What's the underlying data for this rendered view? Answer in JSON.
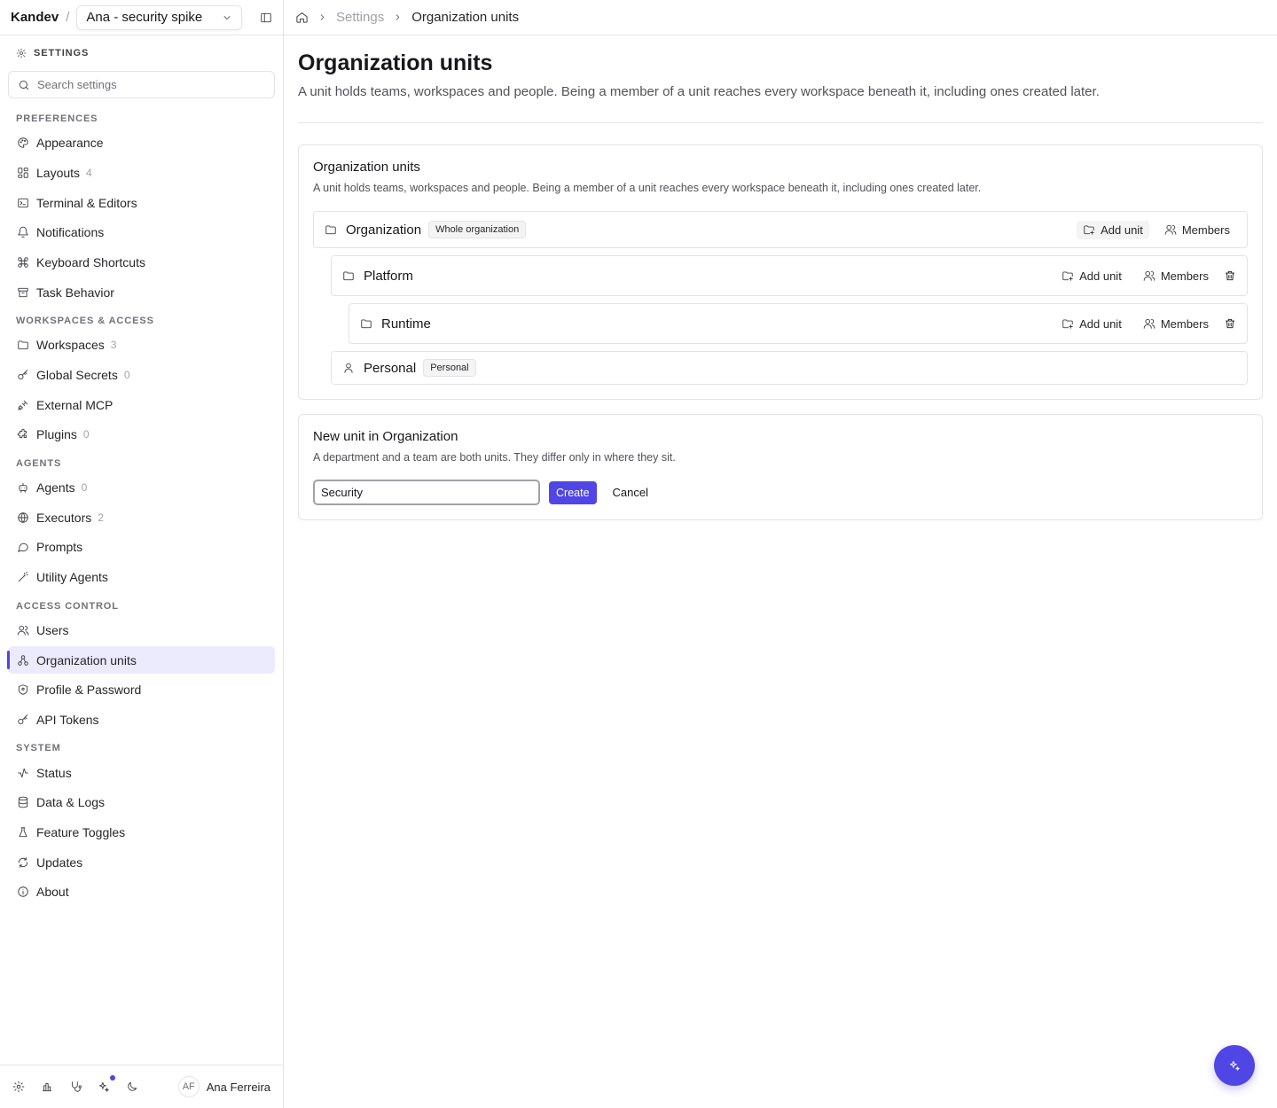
{
  "app": {
    "brand": "Kandev",
    "separator": "/",
    "workspace": "Ana - security spike"
  },
  "sidebar": {
    "heading": "SETTINGS",
    "search_placeholder": "Search settings",
    "groups": [
      {
        "label": "PREFERENCES",
        "items": [
          {
            "label": "Appearance",
            "count": "",
            "icon": "palette-icon"
          },
          {
            "label": "Layouts",
            "count": "4",
            "icon": "layout-icon"
          },
          {
            "label": "Terminal & Editors",
            "count": "",
            "icon": "terminal-icon"
          },
          {
            "label": "Notifications",
            "count": "",
            "icon": "bell-icon"
          },
          {
            "label": "Keyboard Shortcuts",
            "count": "",
            "icon": "command-icon"
          },
          {
            "label": "Task Behavior",
            "count": "",
            "icon": "archive-icon"
          }
        ]
      },
      {
        "label": "WORKSPACES & ACCESS",
        "items": [
          {
            "label": "Workspaces",
            "count": "3",
            "icon": "folder-icon"
          },
          {
            "label": "Global Secrets",
            "count": "0",
            "icon": "key-icon"
          },
          {
            "label": "External MCP",
            "count": "",
            "icon": "plug-icon"
          },
          {
            "label": "Plugins",
            "count": "0",
            "icon": "puzzle-icon"
          }
        ]
      },
      {
        "label": "AGENTS",
        "items": [
          {
            "label": "Agents",
            "count": "0",
            "icon": "bot-icon"
          },
          {
            "label": "Executors",
            "count": "2",
            "icon": "globe-icon"
          },
          {
            "label": "Prompts",
            "count": "",
            "icon": "message-icon"
          },
          {
            "label": "Utility Agents",
            "count": "",
            "icon": "wand-icon"
          }
        ]
      },
      {
        "label": "ACCESS CONTROL",
        "items": [
          {
            "label": "Users",
            "count": "",
            "icon": "users-icon"
          },
          {
            "label": "Organization units",
            "count": "",
            "icon": "network-icon",
            "active": true
          },
          {
            "label": "Profile & Password",
            "count": "",
            "icon": "shield-icon"
          },
          {
            "label": "API Tokens",
            "count": "",
            "icon": "key-icon"
          }
        ]
      },
      {
        "label": "SYSTEM",
        "items": [
          {
            "label": "Status",
            "count": "",
            "icon": "activity-icon"
          },
          {
            "label": "Data & Logs",
            "count": "",
            "icon": "database-icon"
          },
          {
            "label": "Feature Toggles",
            "count": "",
            "icon": "flask-icon"
          },
          {
            "label": "Updates",
            "count": "",
            "icon": "refresh-icon"
          },
          {
            "label": "About",
            "count": "",
            "icon": "info-icon"
          }
        ]
      }
    ],
    "user": {
      "initials": "AF",
      "name": "Ana Ferreira"
    }
  },
  "breadcrumb": {
    "settings": "Settings",
    "current": "Organization units"
  },
  "page": {
    "title": "Organization units",
    "description": "A unit holds teams, workspaces and people. Being a member of a unit reaches every workspace beneath it, including ones created later."
  },
  "units_card": {
    "title": "Organization units",
    "description": "A unit holds teams, workspaces and people. Being a member of a unit reaches every workspace beneath it, including ones created later.",
    "add_unit_label": "Add unit",
    "members_label": "Members",
    "units": {
      "organization": {
        "name": "Organization",
        "badge": "Whole organization"
      },
      "platform": {
        "name": "Platform"
      },
      "runtime": {
        "name": "Runtime"
      },
      "personal": {
        "name": "Personal",
        "badge": "Personal"
      }
    }
  },
  "new_unit": {
    "title": "New unit in Organization",
    "description": "A department and a team are both units. They differ only in where they sit.",
    "input_value": "Security",
    "create_label": "Create",
    "cancel_label": "Cancel"
  },
  "colors": {
    "accent": "#4f46e5",
    "active_bg": "#eceafd",
    "border": "#e4e4e7"
  }
}
